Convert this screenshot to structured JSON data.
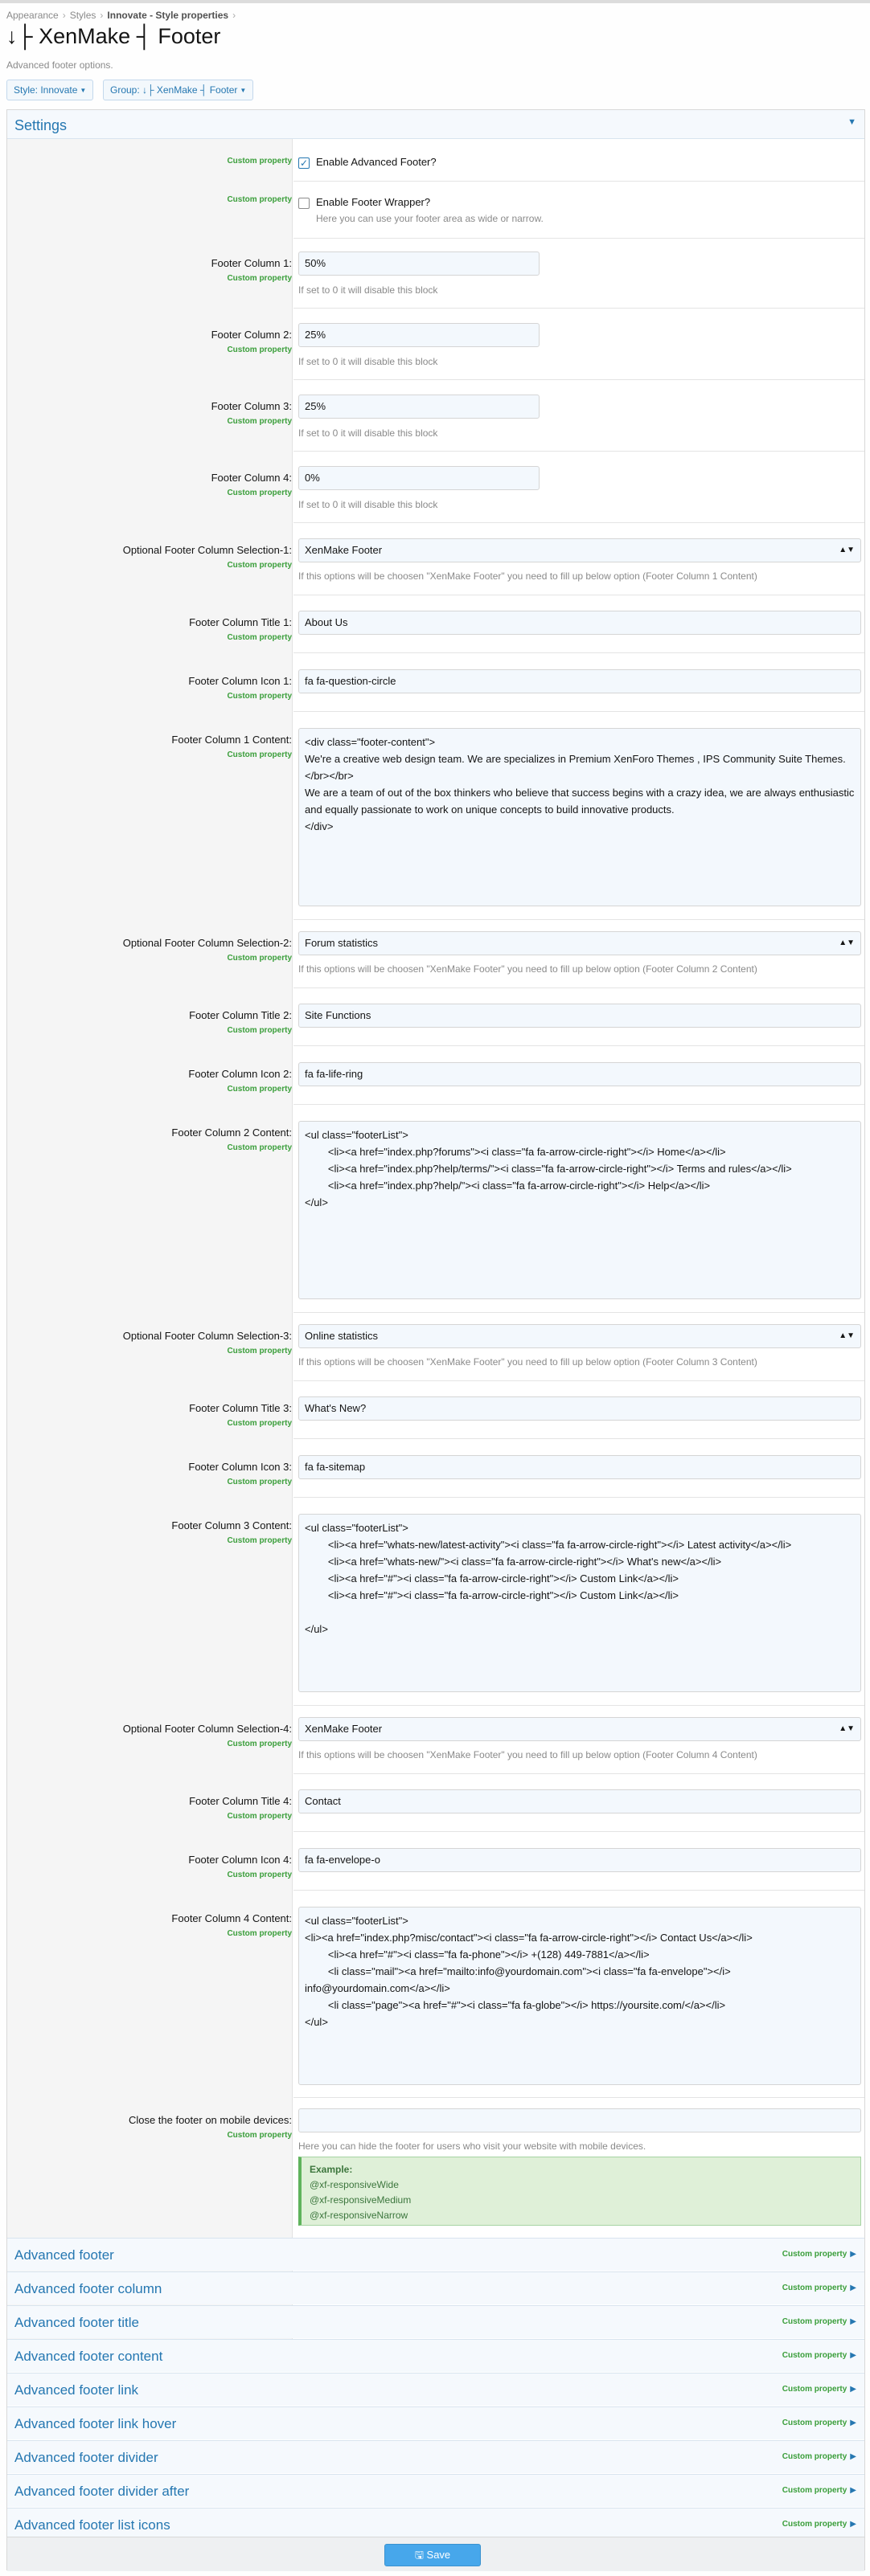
{
  "breadcrumb": [
    "Appearance",
    "Styles",
    "Innovate - Style properties"
  ],
  "page_title": "↓├ XenMake ┤ Footer",
  "page_description": "Advanced footer options.",
  "toolbar": {
    "style_label": "Style: Innovate",
    "group_label": "Group: ↓├ XenMake ┤ Footer"
  },
  "settings_title": "Settings",
  "custom_property": "Custom property",
  "enable_advanced_footer": {
    "label": "Enable Advanced Footer?",
    "checked": true
  },
  "enable_footer_wrapper": {
    "label": "Enable Footer Wrapper?",
    "hint": "Here you can use your footer area as wide or narrow.",
    "checked": false
  },
  "columns": [
    {
      "label": "Footer Column 1:",
      "value": "50%",
      "hint": "If set to 0 it will disable this block"
    },
    {
      "label": "Footer Column 2:",
      "value": "25%",
      "hint": "If set to 0 it will disable this block"
    },
    {
      "label": "Footer Column 3:",
      "value": "25%",
      "hint": "If set to 0 it will disable this block"
    },
    {
      "label": "Footer Column 4:",
      "value": "0%",
      "hint": "If set to 0 it will disable this block"
    }
  ],
  "blocks": [
    {
      "sel_label": "Optional Footer Column Selection-1:",
      "sel_value": "XenMake Footer",
      "sel_hint": "If this options will be choosen \"XenMake Footer\" you need to fill up below option (Footer Column 1 Content)",
      "title_label": "Footer Column Title 1:",
      "title_value": "About Us",
      "icon_label": "Footer Column Icon 1:",
      "icon_value": "fa fa-question-circle",
      "content_label": "Footer Column 1 Content:",
      "content_value": "<div class=\"footer-content\">\nWe're a creative web design team. We are specializes in Premium XenForo Themes , IPS Community Suite Themes. </br></br>\nWe are a team of out of the box thinkers who believe that success begins with a crazy idea, we are always enthusiastic and equally passionate to work on unique concepts to build innovative products.\n</div>"
    },
    {
      "sel_label": "Optional Footer Column Selection-2:",
      "sel_value": "Forum statistics",
      "sel_hint": "If this options will be choosen \"XenMake Footer\" you need to fill up below option (Footer Column 2 Content)",
      "title_label": "Footer Column Title 2:",
      "title_value": "Site Functions",
      "icon_label": "Footer Column Icon 2:",
      "icon_value": "fa fa-life-ring",
      "content_label": "Footer Column 2 Content:",
      "content_value": "<ul class=\"footerList\">\n        <li><a href=\"index.php?forums\"><i class=\"fa fa-arrow-circle-right\"></i> Home</a></li>\n        <li><a href=\"index.php?help/terms/\"><i class=\"fa fa-arrow-circle-right\"></i> Terms and rules</a></li>\n        <li><a href=\"index.php?help/\"><i class=\"fa fa-arrow-circle-right\"></i> Help</a></li>\n</ul>"
    },
    {
      "sel_label": "Optional Footer Column Selection-3:",
      "sel_value": "Online statistics",
      "sel_hint": "If this options will be choosen \"XenMake Footer\" you need to fill up below option (Footer Column 3 Content)",
      "title_label": "Footer Column Title 3:",
      "title_value": "What's New?",
      "icon_label": "Footer Column Icon 3:",
      "icon_value": "fa fa-sitemap",
      "content_label": "Footer Column 3 Content:",
      "content_value": "<ul class=\"footerList\">\n        <li><a href=\"whats-new/latest-activity\"><i class=\"fa fa-arrow-circle-right\"></i> Latest activity</a></li>\n        <li><a href=\"whats-new/\"><i class=\"fa fa-arrow-circle-right\"></i> What's new</a></li>\n        <li><a href=\"#\"><i class=\"fa fa-arrow-circle-right\"></i> Custom Link</a></li>\n        <li><a href=\"#\"><i class=\"fa fa-arrow-circle-right\"></i> Custom Link</a></li>\n\n</ul>"
    },
    {
      "sel_label": "Optional Footer Column Selection-4:",
      "sel_value": "XenMake Footer",
      "sel_hint": "If this options will be choosen \"XenMake Footer\" you need to fill up below option (Footer Column 4 Content)",
      "title_label": "Footer Column Title 4:",
      "title_value": "Contact",
      "icon_label": "Footer Column Icon 4:",
      "icon_value": "fa fa-envelope-o",
      "content_label": "Footer Column 4 Content:",
      "content_value": "<ul class=\"footerList\">\n<li><a href=\"index.php?misc/contact\"><i class=\"fa fa-arrow-circle-right\"></i> Contact Us</a></li>\n        <li><a href=\"#\"><i class=\"fa fa-phone\"></i> +(128) 449-7881</a></li>\n        <li class=\"mail\"><a href=\"mailto:info@yourdomain.com\"><i class=\"fa fa-envelope\"></i> info@yourdomain.com</a></li>\n        <li class=\"page\"><a href=\"#\"><i class=\"fa fa-globe\"></i> https://yoursite.com/</a></li>\n</ul>"
    }
  ],
  "mobile_close": {
    "label": "Close the footer on mobile devices:",
    "value": "",
    "hint": "Here you can hide the footer for users who visit your website with mobile devices.",
    "example_title": "Example:",
    "examples": [
      "@xf-responsiveWide",
      "@xf-responsiveMedium",
      "@xf-responsiveNarrow"
    ]
  },
  "collapsed": [
    "Advanced footer",
    "Advanced footer column",
    "Advanced footer title",
    "Advanced footer content",
    "Advanced footer link",
    "Advanced footer link hover",
    "Advanced footer divider",
    "Advanced footer divider after",
    "Advanced footer list icons"
  ],
  "save_label": "Save",
  "colors": {
    "accent": "#2577b1",
    "custom_property": "#3a9e3a",
    "save": "#47a7eb"
  }
}
